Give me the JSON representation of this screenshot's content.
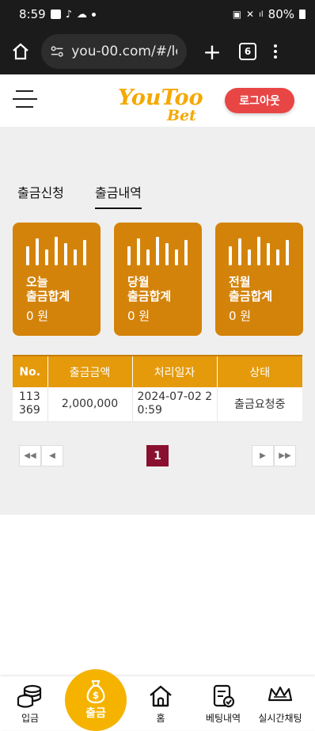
{
  "status_bar": {
    "time": "8:59",
    "battery": "80%"
  },
  "browser": {
    "url": "you-00.com/#/lot",
    "tab_count": "6"
  },
  "header": {
    "logo_line1": "YouToo",
    "logo_line2": "Bet",
    "logout_label": "로그아웃"
  },
  "tabs": [
    {
      "label": "출금신청",
      "active": false
    },
    {
      "label": "출금내역",
      "active": true
    }
  ],
  "summary_cards": [
    {
      "label_line1": "오늘",
      "label_line2": "출금합계",
      "value": "0 원"
    },
    {
      "label_line1": "당월",
      "label_line2": "출금합계",
      "value": "0 원"
    },
    {
      "label_line1": "전월",
      "label_line2": "출금합계",
      "value": "0 원"
    }
  ],
  "table": {
    "headers": [
      "No.",
      "출금금액",
      "처리일자",
      "상태"
    ],
    "rows": [
      {
        "no_line1": "113",
        "no_line2": "369",
        "amount": "2,000,000",
        "date_line1": "2024-07-02 2",
        "date_line2": "0:59",
        "status": "출금요청중"
      }
    ]
  },
  "pagination": {
    "current_page": "1"
  },
  "bottom_nav": [
    {
      "label": "입금",
      "icon": "coins-icon"
    },
    {
      "label": "출금",
      "icon": "money-bag-icon"
    },
    {
      "label": "홈",
      "icon": "home-icon"
    },
    {
      "label": "베팅내역",
      "icon": "betting-history-icon"
    },
    {
      "label": "실시간채팅",
      "icon": "crown-chat-icon"
    }
  ],
  "colors": {
    "accent": "#e49a0b",
    "card": "#d4830a",
    "logout": "#e84545",
    "page_active": "#8a1030",
    "nav_center": "#f5b300"
  }
}
